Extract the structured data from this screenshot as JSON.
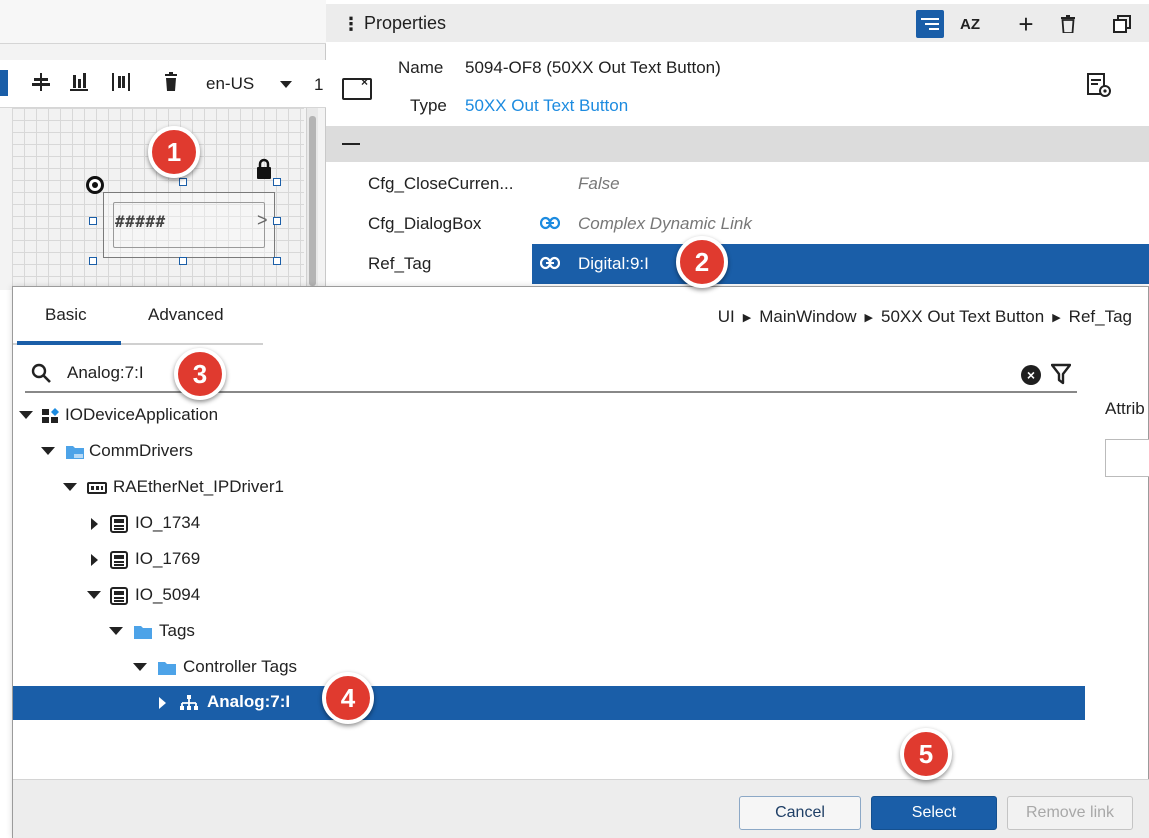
{
  "canvas": {
    "language": "en-US",
    "trailing_text": "1",
    "widget_text": "#####",
    "widget_chevron": ">"
  },
  "properties": {
    "title": "Properties",
    "menu_glyph": "⋮",
    "header_buttons": [
      "filter",
      "sort-az",
      "add",
      "delete",
      "copy"
    ],
    "az_glyph": "AZ",
    "add_glyph": "+",
    "name_label": "Name",
    "name_value": "5094-OF8 (50XX Out Text Button)",
    "type_label": "Type",
    "type_value": "50XX Out Text Button",
    "rows": [
      {
        "name": "Cfg_CloseCurren...",
        "value": "False",
        "linked": false,
        "selected": false
      },
      {
        "name": "Cfg_DialogBox",
        "value": "Complex Dynamic Link",
        "linked": true,
        "selected": false
      },
      {
        "name": "Ref_Tag",
        "value": "Digital:9:I",
        "linked": true,
        "selected": true
      }
    ]
  },
  "dialog": {
    "tabs": [
      {
        "label": "Basic",
        "active": true
      },
      {
        "label": "Advanced",
        "active": false
      }
    ],
    "breadcrumb": [
      "UI",
      "MainWindow",
      "50XX Out Text Button",
      "Ref_Tag"
    ],
    "search_value": "Analog:7:I",
    "clear_glyph": "×",
    "attributes_label": "Attrib",
    "tree": [
      {
        "label": "IODeviceApplication",
        "depth": 0,
        "expanded": true,
        "icon": "application-icon",
        "selected": false
      },
      {
        "label": "CommDrivers",
        "depth": 1,
        "expanded": true,
        "icon": "folder-icon",
        "selected": false
      },
      {
        "label": "RAEtherNet_IPDriver1",
        "depth": 2,
        "expanded": true,
        "icon": "driver-icon",
        "selected": false
      },
      {
        "label": "IO_1734",
        "depth": 3,
        "expanded": false,
        "icon": "device-icon",
        "selected": false
      },
      {
        "label": "IO_1769",
        "depth": 3,
        "expanded": false,
        "icon": "device-icon",
        "selected": false
      },
      {
        "label": "IO_5094",
        "depth": 3,
        "expanded": true,
        "icon": "device-icon",
        "selected": false
      },
      {
        "label": "Tags",
        "depth": 4,
        "expanded": true,
        "icon": "folder-icon",
        "selected": false
      },
      {
        "label": "Controller Tags",
        "depth": 5,
        "expanded": true,
        "icon": "folder-icon",
        "selected": false
      },
      {
        "label": "Analog:7:I",
        "depth": 6,
        "expanded": false,
        "icon": "tag-structure-icon",
        "selected": true
      }
    ],
    "buttons": {
      "cancel": "Cancel",
      "select": "Select",
      "remove": "Remove link"
    }
  },
  "callouts": [
    "1",
    "2",
    "3",
    "4",
    "5"
  ],
  "colors": {
    "accent": "#1a5ea8",
    "link": "#1c8be0",
    "callout": "#e03a2f"
  }
}
